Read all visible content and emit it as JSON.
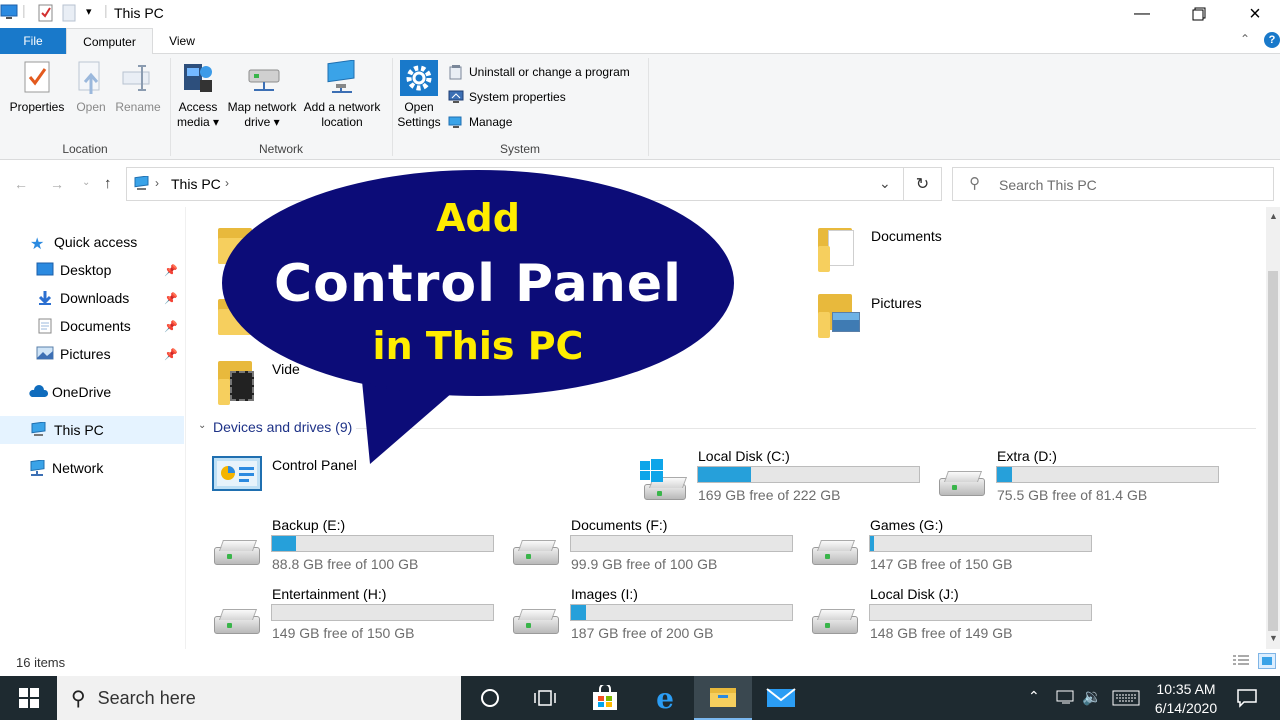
{
  "window": {
    "title": "This PC"
  },
  "ribbon": {
    "tabs": {
      "file": "File",
      "computer": "Computer",
      "view": "View"
    },
    "location_group": {
      "label": "Location",
      "properties": "Properties",
      "open": "Open",
      "rename": "Rename"
    },
    "network_group": {
      "label": "Network",
      "access_media": [
        "Access",
        "media ▾"
      ],
      "map_network_drive": [
        "Map network",
        "drive ▾"
      ],
      "add_network_location": [
        "Add a network",
        "location"
      ]
    },
    "system_group": {
      "label": "System",
      "open_settings": [
        "Open",
        "Settings"
      ],
      "uninstall": "Uninstall or change a program",
      "system_properties": "System properties",
      "manage": "Manage"
    }
  },
  "address": {
    "path": "This PC",
    "search_placeholder": "Search This PC"
  },
  "sidebar": {
    "quick_access": "Quick access",
    "items": [
      {
        "label": "Desktop"
      },
      {
        "label": "Downloads"
      },
      {
        "label": "Documents"
      },
      {
        "label": "Pictures"
      }
    ],
    "onedrive": "OneDrive",
    "this_pc": "This PC",
    "network": "Network"
  },
  "folders": {
    "documents": "Documents",
    "pictures": "Pictures",
    "videos_partial": "Vide"
  },
  "devices": {
    "header": "Devices and drives (9)",
    "control_panel": "Control Panel",
    "drives": [
      {
        "name": "Local Disk (C:)",
        "free": "169 GB free of 222 GB",
        "used_fraction": 0.24
      },
      {
        "name": "Extra (D:)",
        "free": "75.5 GB free of 81.4 GB",
        "used_fraction": 0.07
      },
      {
        "name": "Backup (E:)",
        "free": "88.8 GB free of 100 GB",
        "used_fraction": 0.11
      },
      {
        "name": "Documents (F:)",
        "free": "99.9 GB free of 100 GB",
        "used_fraction": 0.0
      },
      {
        "name": "Games (G:)",
        "free": "147 GB free of 150 GB",
        "used_fraction": 0.02
      },
      {
        "name": "Entertainment (H:)",
        "free": "149 GB free of 150 GB",
        "used_fraction": 0.0
      },
      {
        "name": "Images (I:)",
        "free": "187 GB free of 200 GB",
        "used_fraction": 0.07
      },
      {
        "name": "Local Disk (J:)",
        "free": "148 GB free of 149 GB",
        "used_fraction": 0.0
      }
    ]
  },
  "status": {
    "item_count": "16 items"
  },
  "taskbar": {
    "search_placeholder": "Search here",
    "time": "10:35 AM",
    "date": "6/14/2020"
  },
  "overlay": {
    "line1": "Add",
    "line2": "Control Panel",
    "line3": "in This PC",
    "bubble_color": "#0c0c78",
    "accent_color": "#ffec00"
  }
}
